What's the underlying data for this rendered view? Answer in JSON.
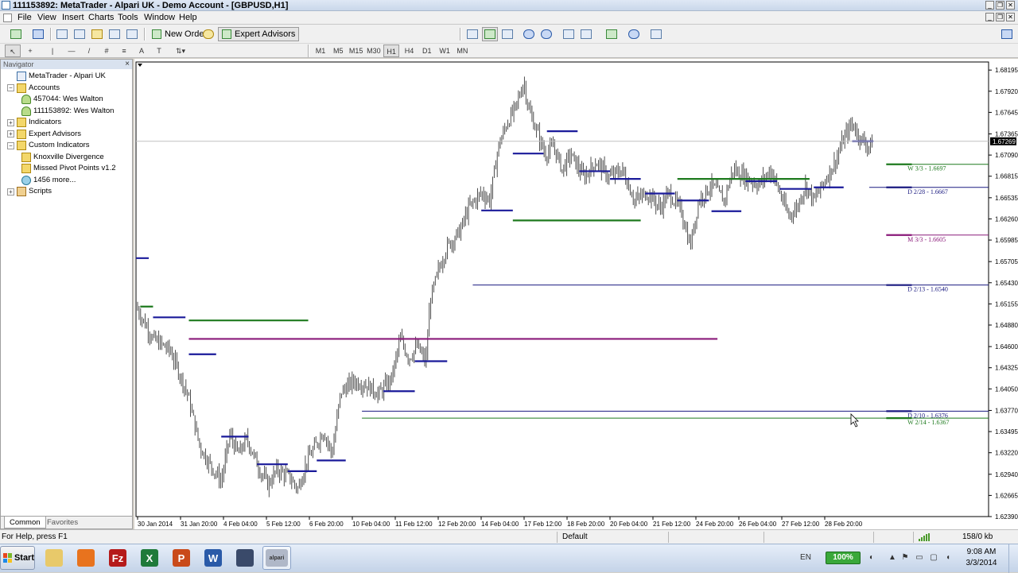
{
  "window": {
    "title": "111153892: MetaTrader - Alpari UK - Demo Account - [GBPUSD,H1]"
  },
  "menu": [
    "File",
    "View",
    "Insert",
    "Charts",
    "Tools",
    "Window",
    "Help"
  ],
  "toolbar": {
    "new_order": "New Order",
    "expert_advisors": "Expert Advisors",
    "drawing_text_tool": "A"
  },
  "timeframes": [
    "M1",
    "M5",
    "M15",
    "M30",
    "H1",
    "H4",
    "D1",
    "W1",
    "MN"
  ],
  "active_timeframe": "H1",
  "navigator": {
    "title": "Navigator",
    "close": "×",
    "tree": [
      {
        "label": "MetaTrader - Alpari UK",
        "level": 0,
        "expander": "",
        "icon": "mt"
      },
      {
        "label": "Accounts",
        "level": 0,
        "expander": "−",
        "icon": "folder"
      },
      {
        "label": "457044: Wes Walton",
        "level": 1,
        "expander": "",
        "icon": "user"
      },
      {
        "label": "111153892: Wes Walton",
        "level": 1,
        "expander": "",
        "icon": "user"
      },
      {
        "label": "Indicators",
        "level": 0,
        "expander": "+",
        "icon": "folder"
      },
      {
        "label": "Expert Advisors",
        "level": 0,
        "expander": "+",
        "icon": "folder"
      },
      {
        "label": "Custom Indicators",
        "level": 0,
        "expander": "−",
        "icon": "folder"
      },
      {
        "label": "Knoxville Divergence",
        "level": 1,
        "expander": "",
        "icon": "folder"
      },
      {
        "label": "Missed Pivot Points v1.2",
        "level": 1,
        "expander": "",
        "icon": "folder"
      },
      {
        "label": "1456 more...",
        "level": 1,
        "expander": "",
        "icon": "globe"
      },
      {
        "label": "Scripts",
        "level": 0,
        "expander": "+",
        "icon": "script"
      }
    ],
    "tabs": [
      "Common",
      "Favorites"
    ],
    "active_tab": "Common"
  },
  "chart_data": {
    "type": "candlestick",
    "symbol": "GBPUSD",
    "timeframe": "H1",
    "current_price": "1.67269",
    "ylim": [
      1.6239,
      1.683
    ],
    "price_ticks": [
      "1.68195",
      "1.67920",
      "1.67645",
      "1.67365",
      "1.67090",
      "1.66815",
      "1.66535",
      "1.66260",
      "1.65985",
      "1.65705",
      "1.65430",
      "1.65155",
      "1.64880",
      "1.64600",
      "1.64325",
      "1.64050",
      "1.63770",
      "1.63495",
      "1.63220",
      "1.62940",
      "1.62665",
      "1.62390"
    ],
    "time_ticks": [
      "30 Jan 2014",
      "31 Jan 20:00",
      "4 Feb 04:00",
      "5 Feb 12:00",
      "6 Feb 20:00",
      "10 Feb 04:00",
      "11 Feb 12:00",
      "12 Feb 20:00",
      "14 Feb 04:00",
      "17 Feb 12:00",
      "18 Feb 20:00",
      "20 Feb 04:00",
      "21 Feb 12:00",
      "24 Feb 20:00",
      "26 Feb 04:00",
      "27 Feb 12:00",
      "28 Feb 20:00"
    ],
    "close_path": [
      [
        0,
        1.6512
      ],
      [
        0.02,
        1.647
      ],
      [
        0.04,
        1.6455
      ],
      [
        0.06,
        1.64
      ],
      [
        0.075,
        1.633
      ],
      [
        0.085,
        1.631
      ],
      [
        0.1,
        1.6285
      ],
      [
        0.11,
        1.6345
      ],
      [
        0.12,
        1.632
      ],
      [
        0.13,
        1.634
      ],
      [
        0.145,
        1.63
      ],
      [
        0.155,
        1.628
      ],
      [
        0.165,
        1.63
      ],
      [
        0.18,
        1.629
      ],
      [
        0.19,
        1.6275
      ],
      [
        0.2,
        1.631
      ],
      [
        0.21,
        1.633
      ],
      [
        0.22,
        1.635
      ],
      [
        0.23,
        1.632
      ],
      [
        0.24,
        1.64
      ],
      [
        0.255,
        1.6415
      ],
      [
        0.27,
        1.641
      ],
      [
        0.285,
        1.6398
      ],
      [
        0.3,
        1.642
      ],
      [
        0.31,
        1.647
      ],
      [
        0.32,
        1.6445
      ],
      [
        0.33,
        1.646
      ],
      [
        0.34,
        1.644
      ],
      [
        0.345,
        1.652
      ],
      [
        0.355,
        1.656
      ],
      [
        0.365,
        1.659
      ],
      [
        0.38,
        1.661
      ],
      [
        0.39,
        1.664
      ],
      [
        0.405,
        1.666
      ],
      [
        0.415,
        1.665
      ],
      [
        0.425,
        1.672
      ],
      [
        0.435,
        1.675
      ],
      [
        0.445,
        1.677
      ],
      [
        0.455,
        1.6805
      ],
      [
        0.46,
        1.677
      ],
      [
        0.47,
        1.674
      ],
      [
        0.48,
        1.671
      ],
      [
        0.49,
        1.672
      ],
      [
        0.5,
        1.669
      ],
      [
        0.51,
        1.671
      ],
      [
        0.525,
        1.668
      ],
      [
        0.54,
        1.67
      ],
      [
        0.555,
        1.668
      ],
      [
        0.57,
        1.669
      ],
      [
        0.585,
        1.665
      ],
      [
        0.6,
        1.666
      ],
      [
        0.615,
        1.664
      ],
      [
        0.625,
        1.666
      ],
      [
        0.64,
        1.6635
      ],
      [
        0.65,
        1.659
      ],
      [
        0.66,
        1.665
      ],
      [
        0.675,
        1.667
      ],
      [
        0.69,
        1.665
      ],
      [
        0.7,
        1.669
      ],
      [
        0.715,
        1.668
      ],
      [
        0.73,
        1.667
      ],
      [
        0.745,
        1.669
      ],
      [
        0.755,
        1.666
      ],
      [
        0.765,
        1.663
      ],
      [
        0.775,
        1.664
      ],
      [
        0.785,
        1.667
      ],
      [
        0.795,
        1.665
      ],
      [
        0.81,
        1.668
      ],
      [
        0.82,
        1.67
      ],
      [
        0.83,
        1.673
      ],
      [
        0.84,
        1.675
      ],
      [
        0.85,
        1.673
      ],
      [
        0.86,
        1.672
      ],
      [
        0.865,
        1.6727
      ]
    ],
    "levels": [
      {
        "label": "W 3/3 - 1.6697",
        "price": 1.6697,
        "color": "#1e7a1e",
        "from": 0.88,
        "to": 1.0,
        "label_x": 0.905
      },
      {
        "label": "D 2/28 - 1.6667",
        "price": 1.6667,
        "color": "#1a1a80",
        "from": 0.86,
        "to": 1.0,
        "label_x": 0.905
      },
      {
        "label": "M 3/3 - 1.6605",
        "price": 1.6605,
        "color": "#8a1a7a",
        "from": 0.88,
        "to": 1.0,
        "label_x": 0.905
      },
      {
        "label": "D 2/13 - 1.6540",
        "price": 1.654,
        "color": "#1a1a80",
        "from": 0.395,
        "to": 1.0,
        "label_x": 0.905
      },
      {
        "label": "D 2/10 - 1.6376",
        "price": 1.6376,
        "color": "#1a1a80",
        "from": 0.265,
        "to": 1.0,
        "label_x": 0.905
      },
      {
        "label": "W 2/14 - 1.6367",
        "price": 1.6367,
        "color": "#1e7a1e",
        "from": 0.265,
        "to": 1.0,
        "label_x": 0.905
      }
    ],
    "pivot_segments": [
      {
        "price": 1.6575,
        "color": "#1a1a9a",
        "from": 0.0,
        "to": 0.015
      },
      {
        "price": 1.6512,
        "color": "#1e7a1e",
        "from": 0.005,
        "to": 0.02
      },
      {
        "price": 1.6498,
        "color": "#1a1a9a",
        "from": 0.02,
        "to": 0.058
      },
      {
        "price": 1.6494,
        "color": "#1e7a1e",
        "from": 0.062,
        "to": 0.202
      },
      {
        "price": 1.647,
        "color": "#8a1a7a",
        "from": 0.062,
        "to": 0.682
      },
      {
        "price": 1.645,
        "color": "#1a1a9a",
        "from": 0.062,
        "to": 0.094
      },
      {
        "price": 1.6343,
        "color": "#1a1a9a",
        "from": 0.1,
        "to": 0.132
      },
      {
        "price": 1.6307,
        "color": "#1a1a9a",
        "from": 0.142,
        "to": 0.178
      },
      {
        "price": 1.6298,
        "color": "#1a1a9a",
        "from": 0.178,
        "to": 0.212
      },
      {
        "price": 1.6312,
        "color": "#1a1a9a",
        "from": 0.212,
        "to": 0.246
      },
      {
        "price": 1.6402,
        "color": "#1a1a9a",
        "from": 0.29,
        "to": 0.327
      },
      {
        "price": 1.6441,
        "color": "#1a1a9a",
        "from": 0.327,
        "to": 0.365
      },
      {
        "price": 1.6637,
        "color": "#1a1a9a",
        "from": 0.405,
        "to": 0.442
      },
      {
        "price": 1.6624,
        "color": "#1e7a1e",
        "from": 0.442,
        "to": 0.592
      },
      {
        "price": 1.6711,
        "color": "#1a1a9a",
        "from": 0.442,
        "to": 0.478
      },
      {
        "price": 1.674,
        "color": "#1a1a9a",
        "from": 0.482,
        "to": 0.518
      },
      {
        "price": 1.6688,
        "color": "#1a1a9a",
        "from": 0.52,
        "to": 0.556
      },
      {
        "price": 1.6678,
        "color": "#1a1a9a",
        "from": 0.556,
        "to": 0.592
      },
      {
        "price": 1.6659,
        "color": "#1a1a9a",
        "from": 0.597,
        "to": 0.632
      },
      {
        "price": 1.6678,
        "color": "#1e7a1e",
        "from": 0.635,
        "to": 0.79
      },
      {
        "price": 1.665,
        "color": "#1a1a9a",
        "from": 0.635,
        "to": 0.672
      },
      {
        "price": 1.6636,
        "color": "#1a1a9a",
        "from": 0.675,
        "to": 0.71
      },
      {
        "price": 1.6675,
        "color": "#1a1a9a",
        "from": 0.715,
        "to": 0.752
      },
      {
        "price": 1.6665,
        "color": "#1a1a9a",
        "from": 0.755,
        "to": 0.792
      },
      {
        "price": 1.6667,
        "color": "#1a1a9a",
        "from": 0.795,
        "to": 0.83
      },
      {
        "price": 1.6727,
        "color": "#1a1a9a",
        "from": 0.84,
        "to": 0.865
      }
    ]
  },
  "status": {
    "help": "For Help, press F1",
    "profile": "Default",
    "traffic": "158/0 kb"
  },
  "taskbar": {
    "start": "Start",
    "apps": [
      {
        "name": "explorer-app",
        "glyph": "",
        "color": "#e8c96a"
      },
      {
        "name": "firefox-app",
        "glyph": "",
        "color": "#e8731e"
      },
      {
        "name": "filezilla-app",
        "glyph": "Fz",
        "color": "#b51a1a"
      },
      {
        "name": "excel-app",
        "glyph": "X",
        "color": "#1f7a3a"
      },
      {
        "name": "powerpoint-app",
        "glyph": "P",
        "color": "#c94a1a"
      },
      {
        "name": "word-app",
        "glyph": "W",
        "color": "#2a5aa8"
      },
      {
        "name": "tool-app",
        "glyph": "",
        "color": "#3a4a6a"
      },
      {
        "name": "alpari-app",
        "glyph": "alpari",
        "color": "#b0b8c8"
      }
    ],
    "language": "EN",
    "battery": "100%",
    "time": "9:08 AM",
    "date": "3/3/2014"
  }
}
